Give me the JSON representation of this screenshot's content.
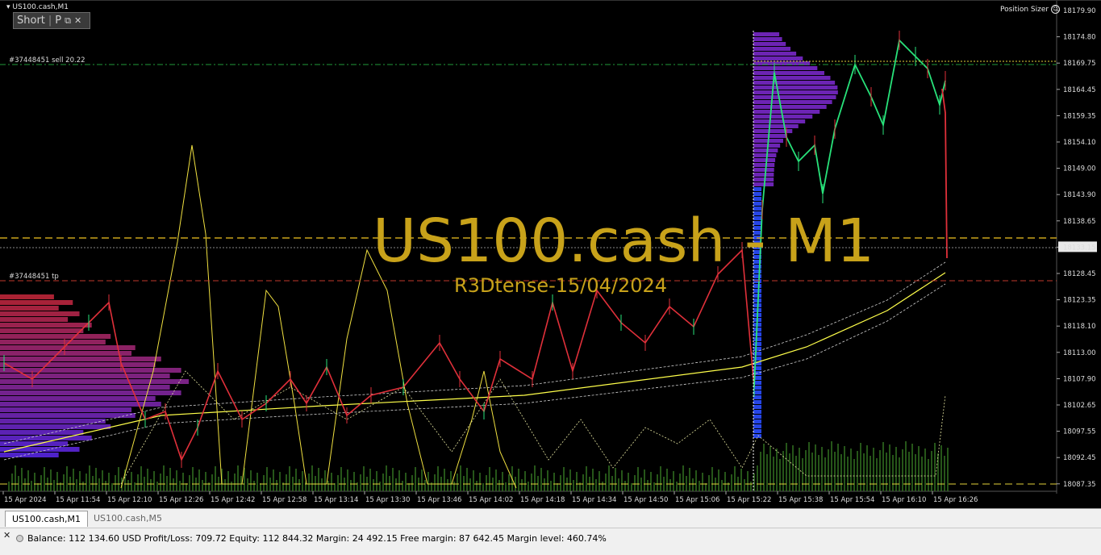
{
  "window": {
    "title": "US100.cash,M1"
  },
  "trade_panel": {
    "side": "Short",
    "letter": "P",
    "icon": "popout-icon"
  },
  "position_sizer": {
    "label": "Position Sizer",
    "icon": "smiley-icon"
  },
  "watermark": {
    "symbol": "US100.cash - M1",
    "subtitle": "R3Dtense-15/04/2024"
  },
  "trade_lines": {
    "sell_label": "#37448451 sell 20.22",
    "tp_label": "#37448451 tp"
  },
  "price_axis": {
    "ticks": [
      "18179.90",
      "18174.80",
      "18169.75",
      "18164.45",
      "18159.35",
      "18154.10",
      "18149.00",
      "18143.90",
      "18138.65",
      "18133.15",
      "18128.45",
      "18123.35",
      "18118.10",
      "18113.00",
      "18107.90",
      "18102.65",
      "18097.55",
      "18092.45",
      "18087.35"
    ],
    "current_price": "18133.15"
  },
  "time_axis": {
    "ticks": [
      "15 Apr 2024",
      "15 Apr 11:54",
      "15 Apr 12:10",
      "15 Apr 12:26",
      "15 Apr 12:42",
      "15 Apr 12:58",
      "15 Apr 13:14",
      "15 Apr 13:30",
      "15 Apr 13:46",
      "15 Apr 14:02",
      "15 Apr 14:18",
      "15 Apr 14:34",
      "15 Apr 14:50",
      "15 Apr 15:06",
      "15 Apr 15:22",
      "15 Apr 15:38",
      "15 Apr 15:54",
      "15 Apr 16:10",
      "15 Apr 16:26"
    ]
  },
  "colors": {
    "bull": "#28e27a",
    "bear": "#e0303a",
    "gold": "#c8a21a",
    "sell_line": "#1f9a3a",
    "tp_line": "#c0392b",
    "ma": "#ffff4a"
  },
  "tabs": [
    {
      "label": "US100.cash,M1",
      "active": true
    },
    {
      "label": "US100.cash,M5",
      "active": false
    }
  ],
  "status": {
    "text": "Balance: 112 134.60 USD  Profit/Loss: 709.72  Equity: 112 844.32  Margin: 24 492.15  Free margin: 87 642.45  Margin level: 460.74%"
  }
}
